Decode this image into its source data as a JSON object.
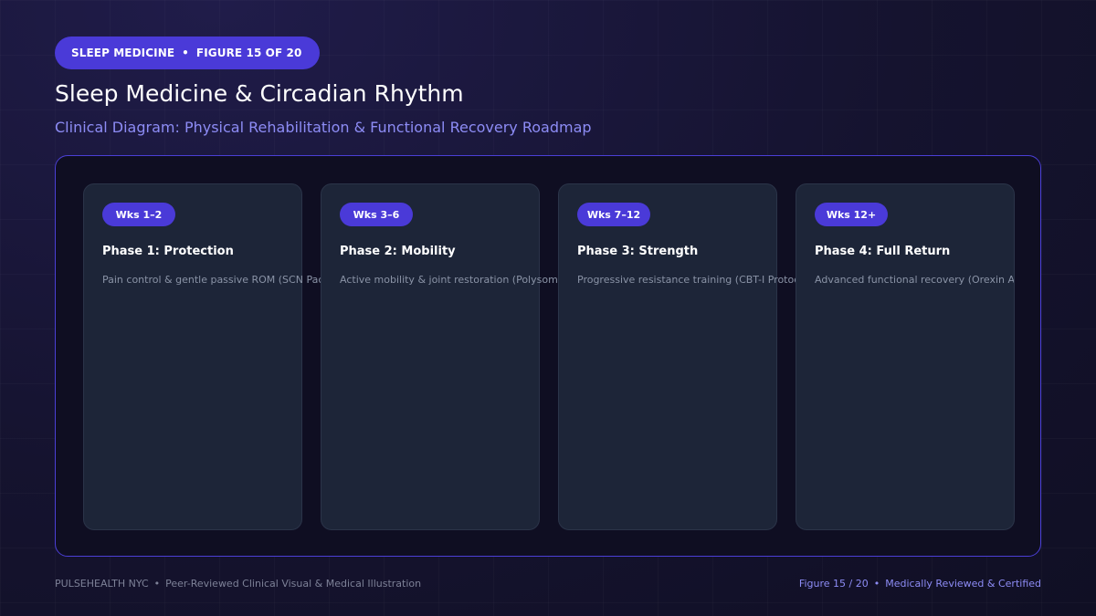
{
  "badge": {
    "category": "SLEEP MEDICINE",
    "separator": "•",
    "figure": "FIGURE 15 OF 20"
  },
  "header": {
    "title": "Sleep Medicine & Circadian Rhythm",
    "subtitle": "Clinical Diagram: Physical Rehabilitation & Functional Recovery Roadmap"
  },
  "phases": [
    {
      "weeks": "Wks 1–2",
      "title": "Phase 1: Protection",
      "description": "Pain control & gentle passive ROM (SCN Pac"
    },
    {
      "weeks": "Wks 3–6",
      "title": "Phase 2: Mobility",
      "description": "Active mobility & joint restoration (Polysomn"
    },
    {
      "weeks": "Wks 7–12",
      "title": "Phase 3: Strength",
      "description": "Progressive resistance training (CBT-I Protoc"
    },
    {
      "weeks": "Wks 12+",
      "title": "Phase 4: Full Return",
      "description": "Advanced functional recovery (Orexin Antagonists)"
    }
  ],
  "footer": {
    "brand": "PULSEHEALTH NYC",
    "separator": "•",
    "tagline": "Peer-Reviewed Clinical Visual & Medical Illustration",
    "figure": "Figure 15 / 20",
    "certification": "Medically Reviewed & Certified"
  },
  "colors": {
    "accent": "#4a3ad8",
    "accent_text": "#8d8cf5",
    "background": "#14122e",
    "card": "#1d2538"
  }
}
